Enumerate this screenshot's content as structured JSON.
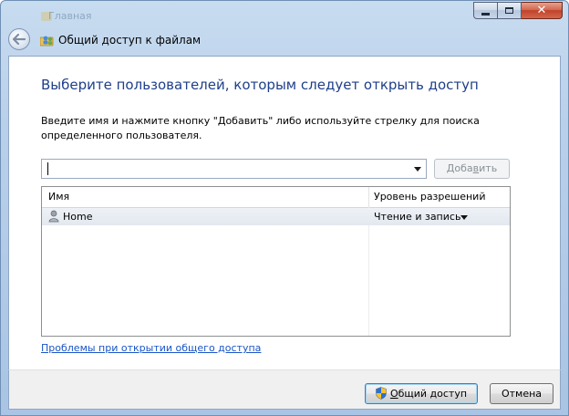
{
  "window": {
    "background_title": "Главная",
    "title": "Общий доступ к файлам",
    "caption": {
      "minimize": "minimize-icon",
      "maximize": "maximize-icon",
      "close": "✕"
    }
  },
  "page": {
    "heading": "Выберите пользователей, которым следует открыть доступ",
    "instruction": "Введите имя и нажмите кнопку \"Добавить\" либо используйте стрелку для поиска определенного пользователя."
  },
  "user_input": {
    "value": "",
    "placeholder": ""
  },
  "add_button": {
    "label_prefix": "Доба",
    "accel": "в",
    "label_suffix": "ить",
    "enabled": false
  },
  "table": {
    "columns": [
      "Имя",
      "Уровень разрешений"
    ],
    "rows": [
      {
        "name": "Home",
        "permission": "Чтение и запись"
      }
    ]
  },
  "help_link": "Проблемы при открытии общего доступа",
  "footer": {
    "share": {
      "accel": "О",
      "label_rest": "бщий доступ"
    },
    "cancel": "Отмена"
  },
  "colors": {
    "heading": "#1e3f8a",
    "link": "#1a55c8",
    "frame": "#b9d0ea"
  }
}
